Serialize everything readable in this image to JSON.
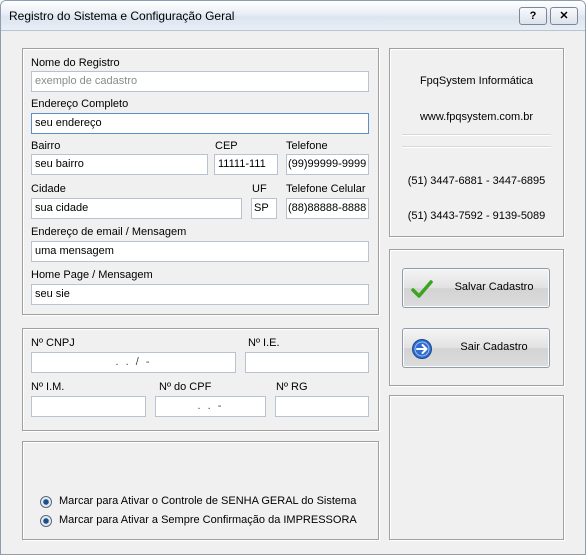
{
  "window": {
    "title": "Registro do Sistema e Configuração Geral",
    "help_label": "?",
    "close_label": "✕"
  },
  "registro": {
    "nome_label": "Nome do Registro",
    "nome_placeholder": "exemplo de cadastro",
    "endereco_label": "Endereço Completo",
    "endereco_value": "seu endereço",
    "bairro_label": "Bairro",
    "bairro_value": "seu bairro",
    "cep_label": "CEP",
    "cep_value": "11111-111",
    "telefone_label": "Telefone",
    "telefone_value": "(99)99999-9999",
    "cidade_label": "Cidade",
    "cidade_value": "sua cidade",
    "uf_label": "UF",
    "uf_value": "SP",
    "celular_label": "Telefone Celular",
    "celular_value": "(88)88888-8888",
    "email_label": "Endereço de email / Mensagem",
    "email_value": "uma mensagem",
    "homepage_label": "Home Page / Mensagem",
    "homepage_value": "seu sie"
  },
  "documentos": {
    "cnpj_label": "Nº CNPJ",
    "cnpj_mask": ". . / -",
    "ie_label": "Nº I.E.",
    "im_label": "Nº I.M.",
    "cpf_label": "Nº do CPF",
    "cpf_mask": ". . -",
    "rg_label": "Nº RG"
  },
  "opcoes": {
    "senha_label": "Marcar para Ativar o Controle de SENHA GERAL do Sistema",
    "impressora_label": "Marcar para Ativar a Sempre Confirmação da IMPRESSORA"
  },
  "info": {
    "company": "FpqSystem Informática",
    "website": "www.fpqsystem.com.br",
    "phones_1": "(51) 3447-6881 - 3447-6895",
    "phones_2": "(51) 3443-7592 - 9139-5089"
  },
  "actions": {
    "salvar_label": "Salvar Cadastro",
    "sair_label": "Sair Cadastro"
  },
  "colors": {
    "check_green": "#3aa61f",
    "arrow_blue": "#2f6bd0"
  }
}
